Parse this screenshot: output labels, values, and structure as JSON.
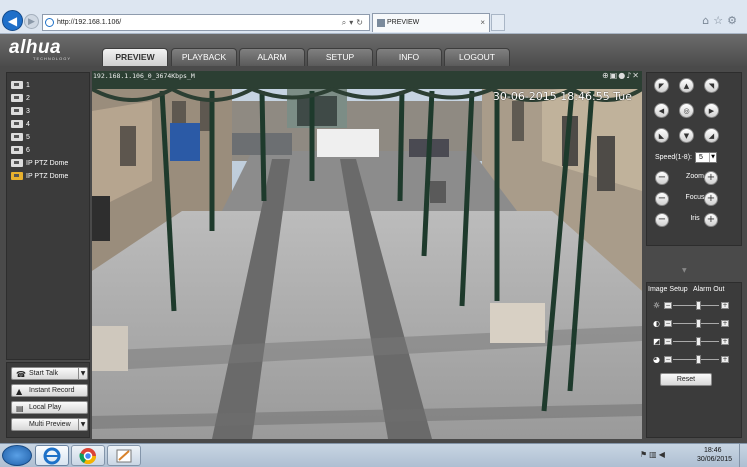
{
  "browser": {
    "url": "http://192.168.1.106/",
    "tab_title": "PREVIEW",
    "tab_close": "×"
  },
  "header": {
    "logo": "alhua",
    "logo_sub": "TECHNOLOGY",
    "nav": [
      "PREVIEW",
      "PLAYBACK",
      "ALARM",
      "SETUP",
      "INFO",
      "LOGOUT"
    ],
    "active_nav": "PREVIEW"
  },
  "channels": [
    "1",
    "2",
    "3",
    "4",
    "5",
    "6",
    "IP PTZ Dome",
    "IP PTZ Dome"
  ],
  "left_buttons": {
    "start_talk": "Start Talk",
    "instant_record": "Instant Record",
    "local_play": "Local Play",
    "multi_preview": "Multi Preview"
  },
  "video": {
    "info": "192.168.1.106_0_3674Kbps_M",
    "osd": "30-06-2015 18:46:55 Tue"
  },
  "ptz": {
    "speed_label": "Speed(1-8):",
    "speed_value": "5",
    "zoom": "Zoom",
    "focus": "Focus",
    "iris": "Iris"
  },
  "image_setup": {
    "tab_image": "Image Setup",
    "tab_alarm": "Alarm Out",
    "reset": "Reset",
    "levels": [
      0.55,
      0.55,
      0.55,
      0.55
    ]
  },
  "taskbar": {
    "time": "18:46",
    "date": "30/06/2015"
  },
  "colors": {
    "brand": "#4a4a4a",
    "accent": "#1f6fc9"
  }
}
